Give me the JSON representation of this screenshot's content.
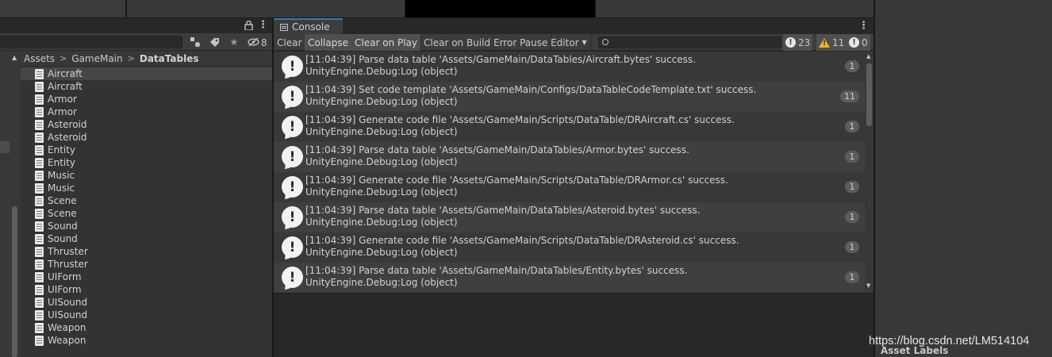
{
  "project": {
    "toolbar": {
      "hidden_count": "8"
    },
    "breadcrumb": [
      "Assets",
      "GameMain",
      "DataTables"
    ],
    "files": [
      "Aircraft",
      "Aircraft",
      "Armor",
      "Armor",
      "Asteroid",
      "Asteroid",
      "Entity",
      "Entity",
      "Music",
      "Music",
      "Scene",
      "Scene",
      "Sound",
      "Sound",
      "Thruster",
      "Thruster",
      "UIForm",
      "UIForm",
      "UISound",
      "UISound",
      "Weapon",
      "Weapon"
    ],
    "selected_index": 0
  },
  "console": {
    "tab_label": "Console",
    "buttons": {
      "clear": "Clear",
      "collapse": "Collapse",
      "clear_on_play": "Clear on Play",
      "clear_on_build": "Clear on Build",
      "error_pause": "Error Pause",
      "editor": "Editor"
    },
    "active_buttons": [
      "collapse",
      "clear_on_play"
    ],
    "counts": {
      "info": "23",
      "warnings": "11",
      "errors": "0"
    },
    "search_placeholder": "",
    "logs": [
      {
        "line1": "[11:04:39] Parse data table 'Assets/GameMain/DataTables/Aircraft.bytes' success.",
        "line2": "UnityEngine.Debug:Log (object)",
        "count": "1"
      },
      {
        "line1": "[11:04:39] Set code template 'Assets/GameMain/Configs/DataTableCodeTemplate.txt' success.",
        "line2": "UnityEngine.Debug:Log (object)",
        "count": "11"
      },
      {
        "line1": "[11:04:39] Generate code file 'Assets/GameMain/Scripts/DataTable/DRAircraft.cs' success.",
        "line2": "UnityEngine.Debug:Log (object)",
        "count": "1"
      },
      {
        "line1": "[11:04:39] Parse data table 'Assets/GameMain/DataTables/Armor.bytes' success.",
        "line2": "UnityEngine.Debug:Log (object)",
        "count": "1"
      },
      {
        "line1": "[11:04:39] Generate code file 'Assets/GameMain/Scripts/DataTable/DRArmor.cs' success.",
        "line2": "UnityEngine.Debug:Log (object)",
        "count": "1"
      },
      {
        "line1": "[11:04:39] Parse data table 'Assets/GameMain/DataTables/Asteroid.bytes' success.",
        "line2": "UnityEngine.Debug:Log (object)",
        "count": "1"
      },
      {
        "line1": "[11:04:39] Generate code file 'Assets/GameMain/Scripts/DataTable/DRAsteroid.cs' success.",
        "line2": "UnityEngine.Debug:Log (object)",
        "count": "1"
      },
      {
        "line1": "[11:04:39] Parse data table 'Assets/GameMain/DataTables/Entity.bytes' success.",
        "line2": "UnityEngine.Debug:Log (object)",
        "count": "1"
      }
    ]
  },
  "inspector": {
    "asset_labels": "Asset Labels"
  },
  "watermark": "https://blog.csdn.net/LM514104",
  "colors": {
    "accent_tab": "#3a79bb",
    "warning": "#f0b429",
    "panel": "#383838"
  },
  "icons": {
    "lock": "lock-icon",
    "kebab": "kebab-menu-icon",
    "search": "search-icon",
    "filter_type": "filter-by-type-icon",
    "label": "filter-by-label-icon",
    "favorite": "star-icon",
    "hidden": "eye-slash-icon",
    "file": "text-asset-icon",
    "log": "info-speech-bubble-icon"
  }
}
